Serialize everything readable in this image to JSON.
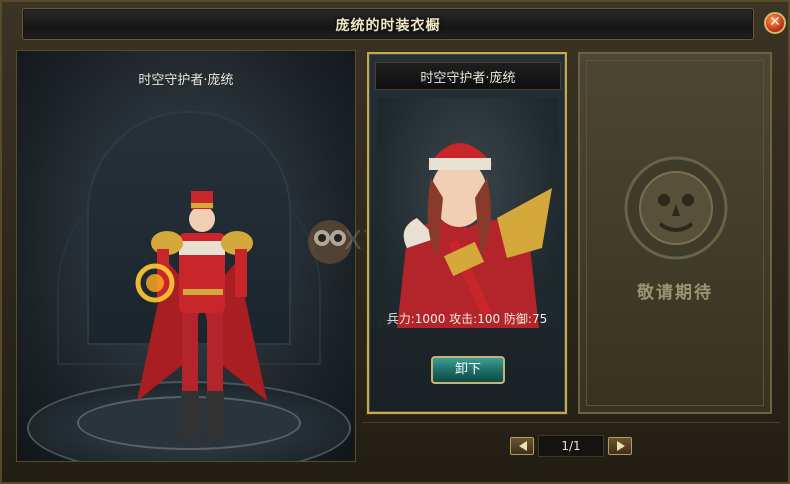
{
  "window": {
    "title": "庞统的时装衣橱",
    "close_label": "✕"
  },
  "preview": {
    "character_name": "时空守护者·庞统"
  },
  "costume_card": {
    "name": "时空守护者·庞统",
    "stats": "兵力:1000 攻击:100 防御:75",
    "unequip_label": "卸下"
  },
  "locked_card": {
    "label": "敬请期待"
  },
  "pagination": {
    "indicator": "1/1"
  },
  "watermark": {
    "text": "XY"
  },
  "colors": {
    "frame_gold": "#c9a94c",
    "button_teal": "#1c6b64",
    "costume_red": "#c8262a"
  }
}
